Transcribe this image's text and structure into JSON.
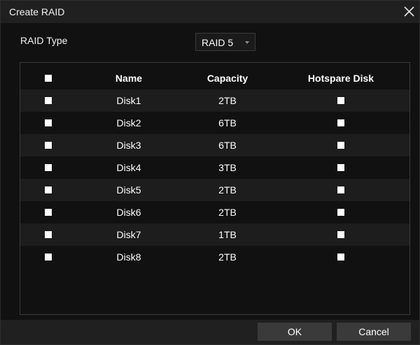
{
  "dialog": {
    "title": "Create RAID",
    "raid_type_label": "RAID Type",
    "raid_type_value": "RAID 5"
  },
  "table": {
    "columns": {
      "name": "Name",
      "capacity": "Capacity",
      "hotspare": "Hotspare Disk"
    },
    "rows": [
      {
        "name": "Disk1",
        "capacity": "2TB"
      },
      {
        "name": "Disk2",
        "capacity": "6TB"
      },
      {
        "name": "Disk3",
        "capacity": "6TB"
      },
      {
        "name": "Disk4",
        "capacity": "3TB"
      },
      {
        "name": "Disk5",
        "capacity": "2TB"
      },
      {
        "name": "Disk6",
        "capacity": "2TB"
      },
      {
        "name": "Disk7",
        "capacity": "1TB"
      },
      {
        "name": "Disk8",
        "capacity": "2TB"
      }
    ]
  },
  "buttons": {
    "ok": "OK",
    "cancel": "Cancel"
  },
  "icons": {
    "close": "close-icon",
    "caret": "caret-down-icon",
    "checkbox": "checkbox-icon"
  },
  "colors": {
    "background": "#111111",
    "titlebar": "#202020",
    "row_alt": "#1d1d1d",
    "button": "#3a3a3a",
    "text": "#ffffff"
  }
}
